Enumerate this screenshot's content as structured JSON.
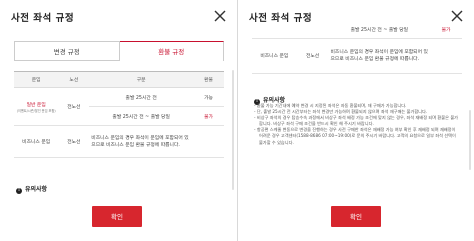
{
  "colors": {
    "accent": "#c8102e",
    "button": "#d7262e"
  },
  "left": {
    "title": "사전 좌석 규정",
    "close_icon": "close-icon",
    "tabs": [
      "변경 규정",
      "환불 규정"
    ],
    "active_tab": 1,
    "table": {
      "headers": [
        "운임",
        "노선",
        "구분",
        "환불"
      ],
      "rows": [
        {
          "fare": "일반 운임",
          "fare_sub": "(이벤트/시즌/할인 운임 포함)",
          "route": "전노선",
          "cond": "출발 25시간 전",
          "result": "가능"
        },
        {
          "cond": "출발 25시간 전 ~ 출발 당일",
          "result": "불가"
        },
        {
          "fare": "비즈니스 운임",
          "route": "전노선",
          "cond": "비즈니스 운임의 경우 좌석이 운임에 포함되어 있으므로 비즈니스 운임 환불 규정에 따릅니다.",
          "result": ""
        }
      ]
    },
    "notice_title": "유의사항",
    "confirm": "확인"
  },
  "right": {
    "title": "사전 좌석 규정",
    "close_icon": "close-icon",
    "table": {
      "rows": [
        {
          "cond": "출발 25시간 전 ~ 출발 당일",
          "result": "불가"
        },
        {
          "fare": "비즈니스 운임",
          "route": "전노선",
          "cond": "비즈니스 운임의 경우 좌석이 운임에 포함되어 있으므로 비즈니스 운임 환불 규정에 따릅니다.",
          "result": ""
        }
      ]
    },
    "notice_title": "유의사항",
    "notes": [
      "환불 가능 기간내에 예약 변경 시 지정된 좌석은 자동 환불되며, 재 구매가 가능합니다.",
      "단, 출발 25시간 전 시간부터는 좌석 변경만 가능하며 환불되지 않으며 좌석 재구매는 불가합니다.",
      "비상구 좌석의 경우 탑승수속 과정에서 비상구 좌석 배정 가능 조건에 맞지 않는 경우, 좌석 재배정 되며 환불은 불가합니다. 비상구 좌석 구매 조건을 반드시 확인 해 주시기 바랍니다.",
      "항공편 스케줄 변동으로 변경을 진행하는 경우 사전 구매한 좌석은 재배정 가능 여부 확인 후 재배정 되며 재배정이 어려운 경우 고객센터(1588-8686 07:00~19:00)로 문의 주시기 바랍니다. 고객의 요청으로 일부 좌석 선택이 불가할 수 있습니다."
    ],
    "confirm": "확인"
  }
}
